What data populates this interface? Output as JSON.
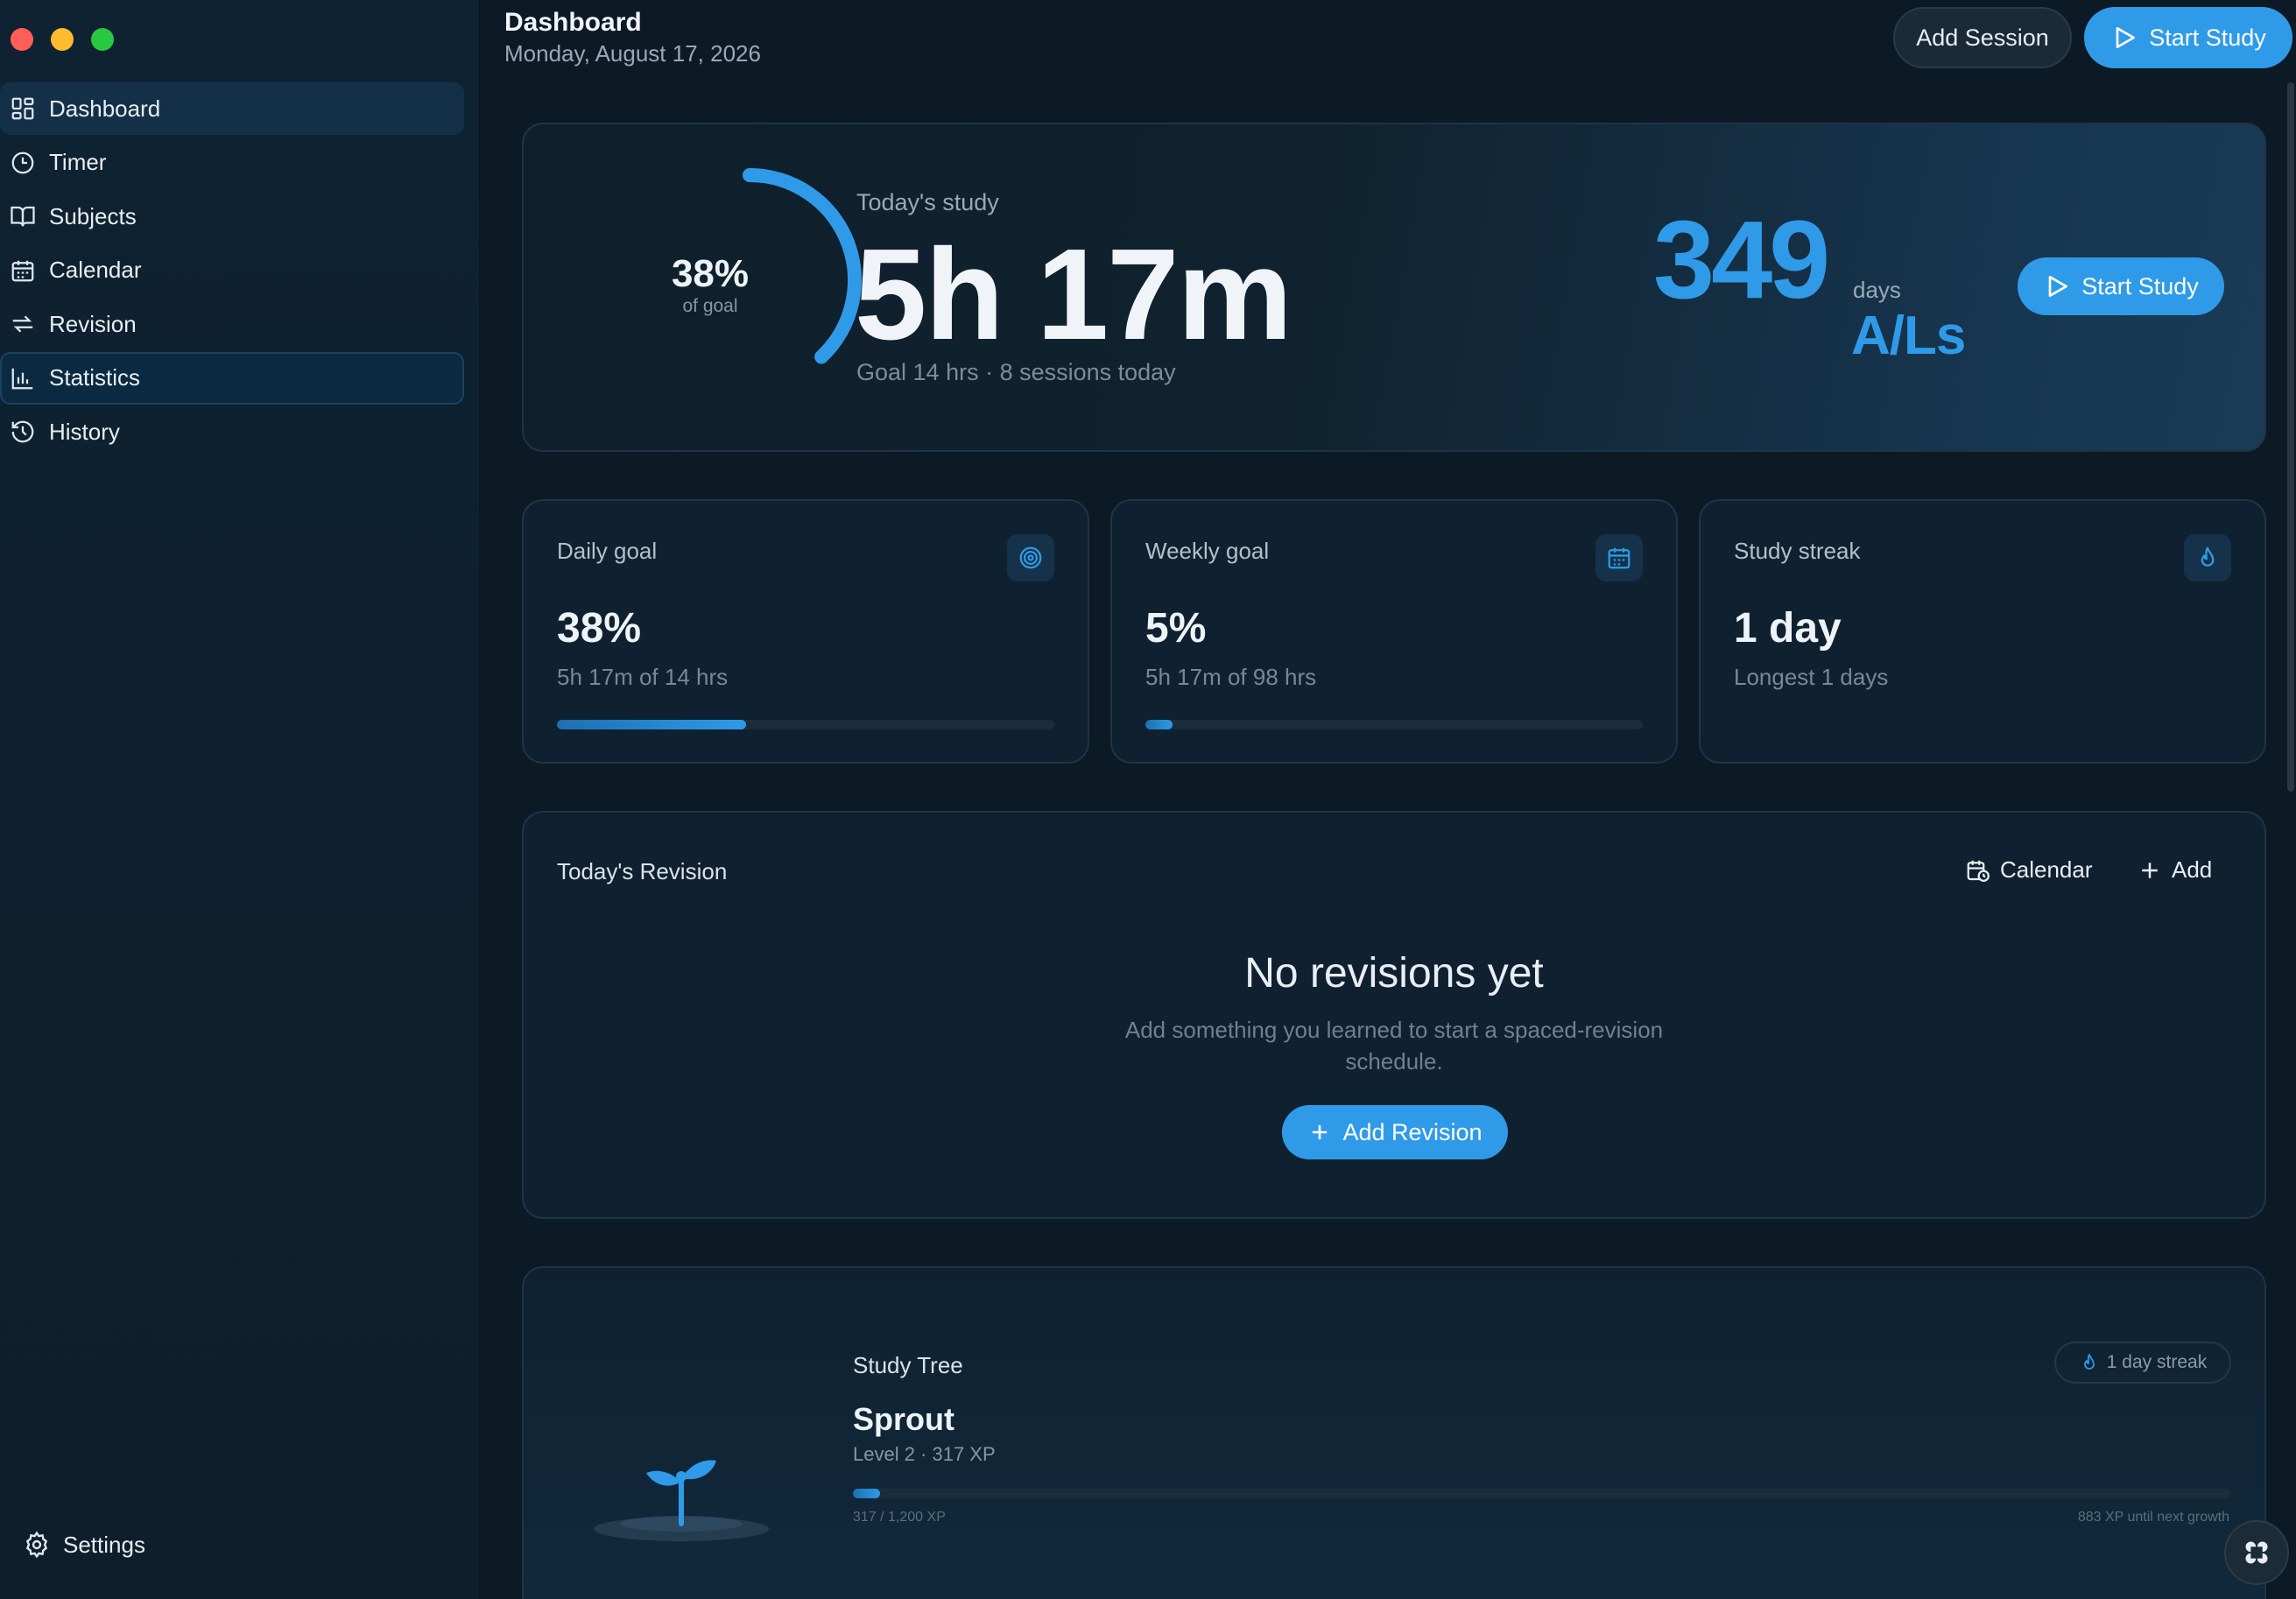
{
  "window": {
    "controls": [
      "close",
      "minimize",
      "zoom"
    ]
  },
  "sidebar": {
    "items": [
      {
        "label": "Dashboard",
        "icon": "grid-icon",
        "state": "active"
      },
      {
        "label": "Timer",
        "icon": "clock-icon"
      },
      {
        "label": "Subjects",
        "icon": "book-icon"
      },
      {
        "label": "Calendar",
        "icon": "calendar-icon"
      },
      {
        "label": "Revision",
        "icon": "repeat-icon"
      },
      {
        "label": "Statistics",
        "icon": "bar-chart-icon",
        "state": "focused"
      },
      {
        "label": "History",
        "icon": "history-icon"
      }
    ],
    "settings_label": "Settings"
  },
  "header": {
    "title": "Dashboard",
    "date": "Monday, August 17, 2026",
    "add_session_label": "Add Session",
    "start_study_label": "Start Study"
  },
  "hero": {
    "ring_percent": "38%",
    "ring_sub": "of goal",
    "ring_progress": 0.38,
    "today_label": "Today's study",
    "today_time": "5h 17m",
    "today_goal": "Goal 14 hrs · 8 sessions today",
    "countdown_value": "349",
    "countdown_unit": "days",
    "countdown_target": "A/Ls",
    "start_study_label": "Start Study"
  },
  "stats": [
    {
      "title": "Daily goal",
      "value": "38%",
      "sub": "5h 17m of 14 hrs",
      "progress": 0.38,
      "icon": "target-icon"
    },
    {
      "title": "Weekly goal",
      "value": "5%",
      "sub": "5h 17m of 98 hrs",
      "progress": 0.054,
      "icon": "calendar-icon"
    },
    {
      "title": "Study streak",
      "value": "1 day",
      "sub": "Longest 1 days",
      "icon": "flame-icon"
    }
  ],
  "revision": {
    "title": "Today's Revision",
    "calendar_label": "Calendar",
    "add_label": "Add",
    "empty_title": "No revisions yet",
    "empty_hint_line1": "Add something you learned to start a spaced-revision",
    "empty_hint_line2": "schedule.",
    "add_revision_label": "Add Revision"
  },
  "tree": {
    "label": "Study Tree",
    "stage": "Sprout",
    "level": "Level 2 · 317 XP",
    "streak_badge": "1 day streak",
    "xp_progress": "317 / 1,200 XP",
    "xp_remaining": "883 XP until next growth",
    "progress": 0.0198
  },
  "colors": {
    "accent": "#2f9be8",
    "background": "#0c1a25",
    "sidebar": "#0f2232",
    "card_border": "#1f3445"
  }
}
